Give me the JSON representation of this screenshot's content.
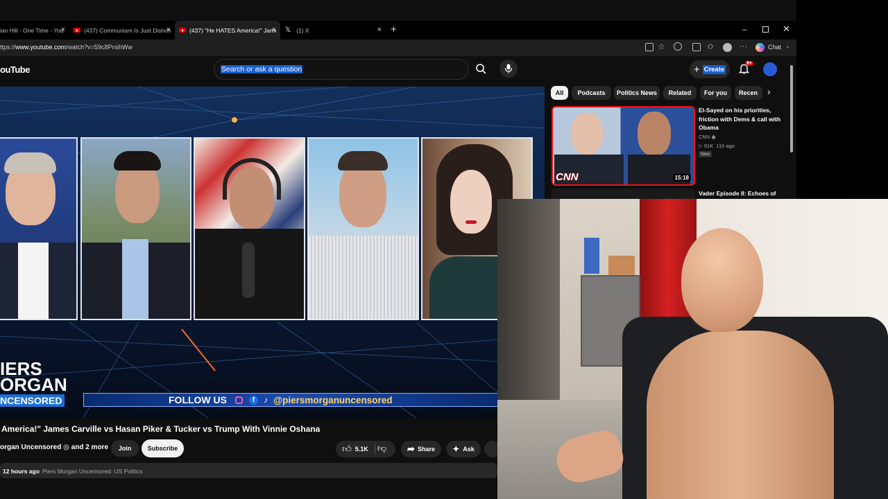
{
  "tabs": [
    {
      "label": "ian Hill - One Time - You"
    },
    {
      "label": "(437) Communism Is Just Dishones"
    },
    {
      "label": "(437) \"He HATES America!\" James"
    },
    {
      "label": "(1) X"
    }
  ],
  "address": {
    "prefix": "ttps://",
    "domain": "www.youtube.com",
    "path": "/watch?v=59c8PrsihWw"
  },
  "toolbar": {
    "chat_label": "Chat"
  },
  "youtube": {
    "logo": "ouTube",
    "search_placeholder": "Search or ask a question",
    "create_label": "Create",
    "notif_badge": "9+"
  },
  "video": {
    "banner_line1": "IERS",
    "banner_line2": "ORGAN",
    "banner_line3": "NCENSORED",
    "follow_label": "FOLLOW US",
    "handle": "@piersmorganuncensored"
  },
  "meta": {
    "title": "America!\" James Carville vs Hasan Piker & Tucker vs Trump With Vinnie Oshana",
    "channel": "organ Uncensored",
    "and_more": "and 2 more",
    "join_label": "Join",
    "subscribe_label": "Subscribe",
    "likes": "5.1K",
    "share_label": "Share",
    "ask_label": "Ask",
    "time_ago": "12 hours ago",
    "category": "Piers Morgan Uncensored: US Politics"
  },
  "chips": [
    "All",
    "Podcasts",
    "Politics News",
    "Related",
    "For you",
    "Recen"
  ],
  "recs": [
    {
      "title_line1": "El-Sayed on his priorities,",
      "title_line2": "friction with Dems & call with",
      "title_line3": "Obama",
      "channel": "CNN",
      "views": "91K",
      "age": "11h ago",
      "badge": "New",
      "duration": "15:18",
      "thumb_logo": "CNN"
    },
    {
      "title_line1": "Vader Episode II: Echoes of"
    }
  ],
  "colors": {
    "accent_blue": "#1c5fcc",
    "yt_red": "#ff0000",
    "background": "#0f0f0f"
  }
}
